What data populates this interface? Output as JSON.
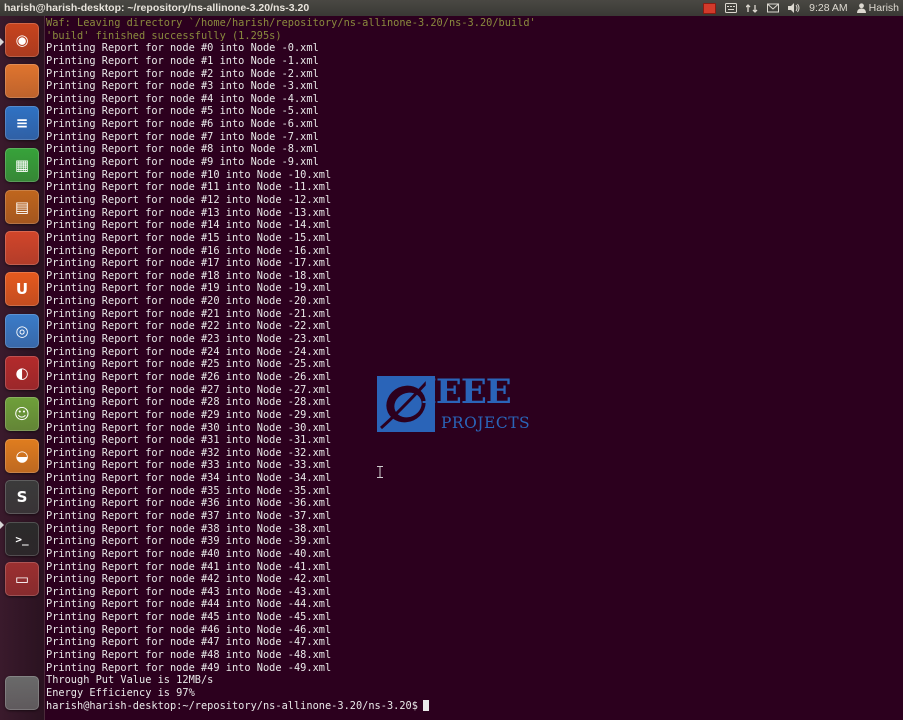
{
  "window": {
    "title": "harish@harish-desktop: ~/repository/ns-allinone-3.20/ns-3.20"
  },
  "panel": {
    "clock": "9:28 AM",
    "user": "Harish",
    "icons": [
      "screen-record-icon",
      "keyboard-layout-icon",
      "network-icon",
      "mail-icon",
      "volume-icon",
      "user-icon"
    ]
  },
  "launcher": {
    "items": [
      {
        "name": "ubuntu-dash-icon",
        "color": "#c8441e"
      },
      {
        "name": "files-icon",
        "color": "#e0752e"
      },
      {
        "name": "writer-icon",
        "color": "#2f72c4"
      },
      {
        "name": "calc-icon",
        "color": "#37a33a"
      },
      {
        "name": "impress-icon",
        "color": "#c0661d"
      },
      {
        "name": "software-center-icon",
        "color": "#d2462a"
      },
      {
        "name": "ubuntu-one-icon",
        "color": "#e65a1e"
      },
      {
        "name": "chromium-icon",
        "color": "#3a7cc9"
      },
      {
        "name": "recorder-icon",
        "color": "#b42b2b"
      },
      {
        "name": "monkey-icon",
        "color": "#6fa03a"
      },
      {
        "name": "blender-icon",
        "color": "#e07d1f"
      },
      {
        "name": "sublime-text-icon",
        "color": "#3b3b3b"
      },
      {
        "name": "terminal-icon",
        "color": "#2b2b2b"
      },
      {
        "name": "workspace-switcher-icon",
        "color": "#9c3030"
      },
      {
        "name": "trash-icon",
        "color": "#6a6a6a"
      }
    ],
    "glyphs": [
      "◉",
      "",
      "≡",
      "▦",
      "▤",
      "",
      "U",
      "◎",
      "◐",
      "☺",
      "◒",
      "S",
      ">_",
      "▭",
      ""
    ]
  },
  "terminal": {
    "lines": [
      "Waf: Leaving directory `/home/harish/repository/ns-allinone-3.20/ns-3.20/build'",
      "'build' finished successfully (1.295s)",
      "Printing Report for node #0 into Node -0.xml",
      "Printing Report for node #1 into Node -1.xml",
      "Printing Report for node #2 into Node -2.xml",
      "Printing Report for node #3 into Node -3.xml",
      "Printing Report for node #4 into Node -4.xml",
      "Printing Report for node #5 into Node -5.xml",
      "Printing Report for node #6 into Node -6.xml",
      "Printing Report for node #7 into Node -7.xml",
      "Printing Report for node #8 into Node -8.xml",
      "Printing Report for node #9 into Node -9.xml",
      "Printing Report for node #10 into Node -10.xml",
      "Printing Report for node #11 into Node -11.xml",
      "Printing Report for node #12 into Node -12.xml",
      "Printing Report for node #13 into Node -13.xml",
      "Printing Report for node #14 into Node -14.xml",
      "Printing Report for node #15 into Node -15.xml",
      "Printing Report for node #16 into Node -16.xml",
      "Printing Report for node #17 into Node -17.xml",
      "Printing Report for node #18 into Node -18.xml",
      "Printing Report for node #19 into Node -19.xml",
      "Printing Report for node #20 into Node -20.xml",
      "Printing Report for node #21 into Node -21.xml",
      "Printing Report for node #22 into Node -22.xml",
      "Printing Report for node #23 into Node -23.xml",
      "Printing Report for node #24 into Node -24.xml",
      "Printing Report for node #25 into Node -25.xml",
      "Printing Report for node #26 into Node -26.xml",
      "Printing Report for node #27 into Node -27.xml",
      "Printing Report for node #28 into Node -28.xml",
      "Printing Report for node #29 into Node -29.xml",
      "Printing Report for node #30 into Node -30.xml",
      "Printing Report for node #31 into Node -31.xml",
      "Printing Report for node #32 into Node -32.xml",
      "Printing Report for node #33 into Node -33.xml",
      "Printing Report for node #34 into Node -34.xml",
      "Printing Report for node #35 into Node -35.xml",
      "Printing Report for node #36 into Node -36.xml",
      "Printing Report for node #37 into Node -37.xml",
      "Printing Report for node #38 into Node -38.xml",
      "Printing Report for node #39 into Node -39.xml",
      "Printing Report for node #40 into Node -40.xml",
      "Printing Report for node #41 into Node -41.xml",
      "Printing Report for node #42 into Node -42.xml",
      "Printing Report for node #43 into Node -43.xml",
      "Printing Report for node #44 into Node -44.xml",
      "Printing Report for node #45 into Node -45.xml",
      "Printing Report for node #46 into Node -46.xml",
      "Printing Report for node #47 into Node -47.xml",
      "Printing Report for node #48 into Node -48.xml",
      "Printing Report for node #49 into Node -49.xml",
      "Through Put Value is 12MB/s",
      "Energy Efficiency is 97%"
    ],
    "prompt": "harish@harish-desktop:~/repository/ns-allinone-3.20/ns-3.20$"
  },
  "watermark": {
    "brand": "IEEE",
    "subtitle": "PROJECTS"
  },
  "colors": {
    "terminal_bg": "#2c001e",
    "terminal_fg": "#e9e9e9",
    "waf_text": "#8a8a3e",
    "watermark": "#2a64b8"
  }
}
